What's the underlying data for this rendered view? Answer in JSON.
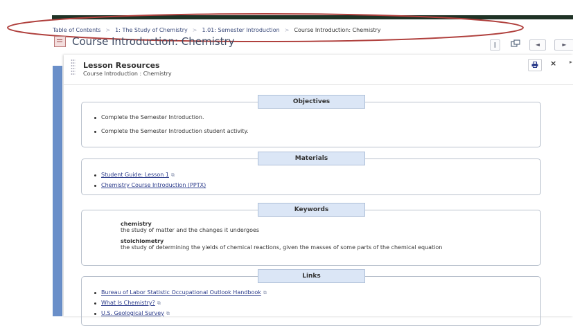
{
  "breadcrumb": {
    "items": [
      "Table of Contents",
      "1: The Study of Chemistry",
      "1.01: Semester Introduction",
      "Course Introduction: Chemistry"
    ],
    "separator": ">"
  },
  "page": {
    "title": "Course Introduction: Chemistry"
  },
  "controls": {
    "prev": "◄",
    "next": "►",
    "bookmark": "∥"
  },
  "panel": {
    "title": "Lesson Resources",
    "subtitle": "Course Introduction : Chemistry",
    "close": "×"
  },
  "sections": {
    "objectives": {
      "title": "Objectives",
      "items": [
        "Complete the Semester Introduction.",
        "Complete the Semester Introduction student activity."
      ]
    },
    "materials": {
      "title": "Materials",
      "items": [
        "Student Guide: Lesson 1",
        "Chemistry Course Introduction (PPTX)"
      ]
    },
    "keywords": {
      "title": "Keywords",
      "items": [
        {
          "term": "chemistry",
          "definition": "the study of matter and the changes it undergoes"
        },
        {
          "term": "stoichiometry",
          "definition": "the study of determining the yields of chemical reactions, given the masses of some parts of the chemical equation"
        }
      ]
    },
    "links": {
      "title": "Links",
      "items": [
        "Bureau of Labor Statistic Occupational Outlook Handbook",
        "What Is Chemistry?",
        "U.S. Geological Survey"
      ]
    }
  },
  "colors": {
    "accent_tab": "#dbe6f6",
    "link": "#2a3a8a",
    "sidebar_strip": "#6a8fc9",
    "annotation": "#b0413e"
  },
  "icons": [
    "page-icon",
    "bookmark-icon",
    "popout-icon",
    "print-icon",
    "close-icon",
    "external-link-icon",
    "drag-handle-icon"
  ]
}
